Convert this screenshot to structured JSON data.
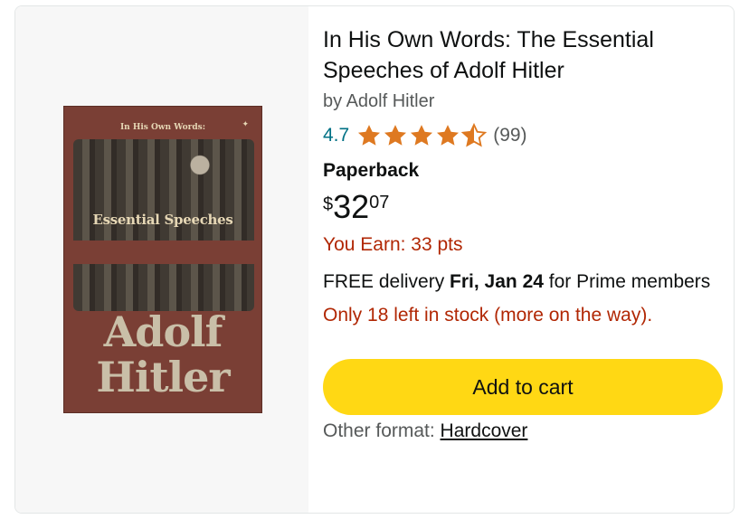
{
  "product": {
    "title_line1": "In His Own Words: The Essential",
    "title_line2": "Speeches of Adolf Hitler",
    "author": "by Adolf Hitler",
    "rating": "4.7",
    "stars": 4.5,
    "rating_count": "(99)",
    "format": "Paperback",
    "price_symbol": "$",
    "price_whole": "32",
    "price_fraction": "07",
    "points": "You Earn: 33 pts",
    "delivery_prefix": "FREE delivery ",
    "delivery_date": "Fri, Jan 24",
    "delivery_suffix": " for Prime members",
    "stock": "Only 18 left in stock (more on the way).",
    "cart_label": "Add to cart",
    "other_format_label": "Other format: ",
    "other_format_link": "Hardcover"
  },
  "cover": {
    "top_text": "In His Own Words:",
    "subtitle": "Essential Speeches",
    "author_line1": "Adolf",
    "author_line2": "Hitler"
  },
  "colors": {
    "star": "#de7921",
    "link": "#007185",
    "alert": "#b12704",
    "button": "#ffd814"
  }
}
